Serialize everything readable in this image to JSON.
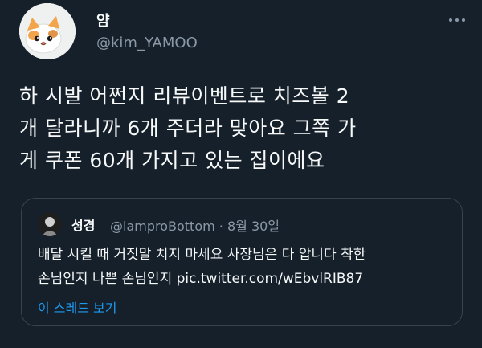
{
  "author": {
    "display_name": "얌",
    "handle": "@kim_YAMOO",
    "avatar_icon": "cartoon-cat-avatar"
  },
  "more_icon": "more-dots-icon",
  "tweet": {
    "text": "하 시발 어쩐지 리뷰이벤트로 치즈볼 2\n개 달라니까 6개 주더라 맞아요 그쪽 가\n게 쿠폰 60개 가지고 있는 집이에요"
  },
  "quoted": {
    "display_name": "성경",
    "handle_date": "@lamproBottom · 8월 30일",
    "text": "배달 시킬 때 거짓말 치지 마세요 사장님은 다 압니다 착한\n손님인지 나쁜 손님인지 pic.twitter.com/wEbvlRIB87",
    "thread_link": "이 스레드 보기",
    "avatar_icon": "dark-profile-avatar"
  },
  "colors": {
    "background": "#15202b",
    "text": "#f7f9f9",
    "secondary": "#8b98a5",
    "link": "#1d9bf0",
    "border": "#38444d"
  }
}
